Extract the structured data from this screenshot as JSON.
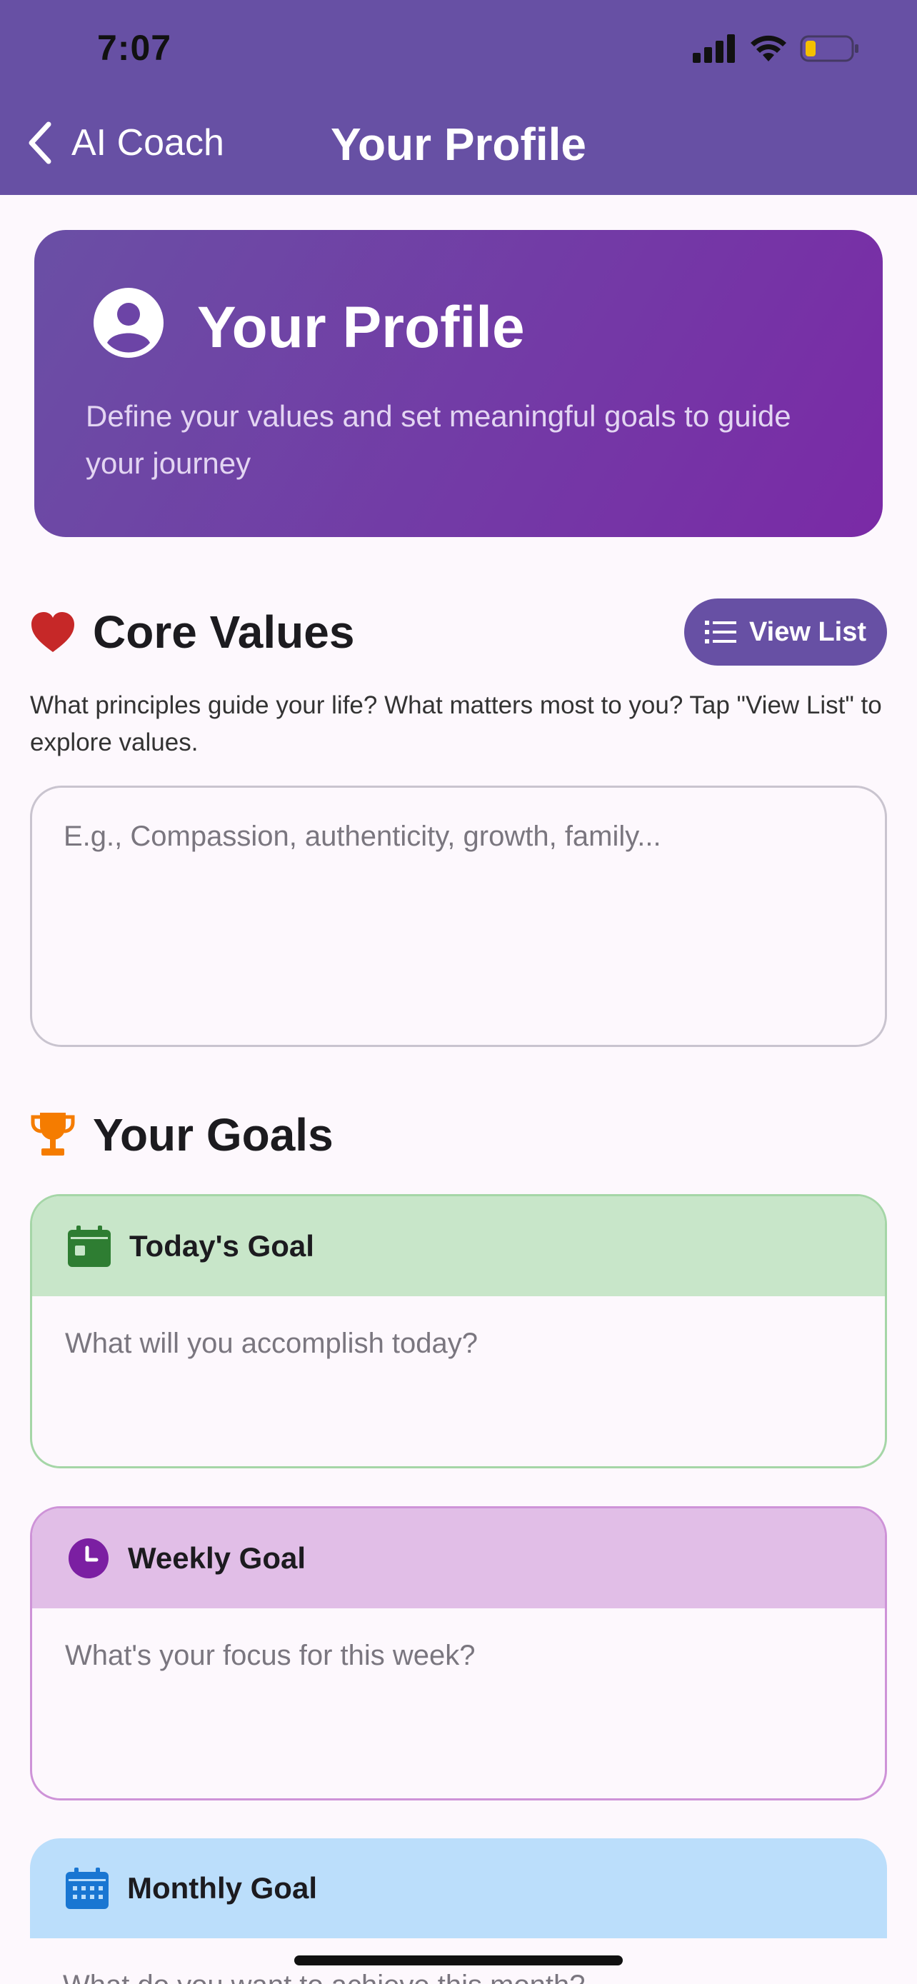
{
  "status_bar": {
    "time": "7:07"
  },
  "nav": {
    "back_label": "AI Coach",
    "title": "Your Profile"
  },
  "hero": {
    "title": "Your Profile",
    "subtitle": "Define your values and set meaningful goals to guide your journey"
  },
  "core_values": {
    "heading": "Core Values",
    "view_list_label": "View List",
    "description": "What principles guide your life? What matters most to you? Tap \"View List\" to explore values.",
    "placeholder": "E.g., Compassion, authenticity, growth, family..."
  },
  "goals": {
    "heading": "Your Goals",
    "today": {
      "label": "Today's Goal",
      "placeholder": "What will you accomplish today?"
    },
    "weekly": {
      "label": "Weekly Goal",
      "placeholder": "What's your focus for this week?"
    },
    "monthly": {
      "label": "Monthly Goal",
      "placeholder": "What do you want to achieve this month?"
    }
  },
  "colors": {
    "primary": "#6750a4",
    "today_bg": "#c8e6c9",
    "today_border": "#a5d6a7",
    "today_icon": "#2e7d32",
    "weekly_bg": "#e1bee7",
    "weekly_border": "#ce93d8",
    "weekly_icon": "#7b1fa2",
    "monthly_bg": "#bbdefb",
    "monthly_icon": "#1976d2",
    "heart": "#c62828",
    "trophy": "#f57c00"
  },
  "icons": {
    "back": "chevron-left-icon",
    "hero": "account-circle-icon",
    "core_values": "heart-icon",
    "view_list": "list-icon",
    "goals": "trophy-icon",
    "today": "calendar-today-icon",
    "weekly": "clock-icon",
    "monthly": "calendar-month-icon"
  }
}
